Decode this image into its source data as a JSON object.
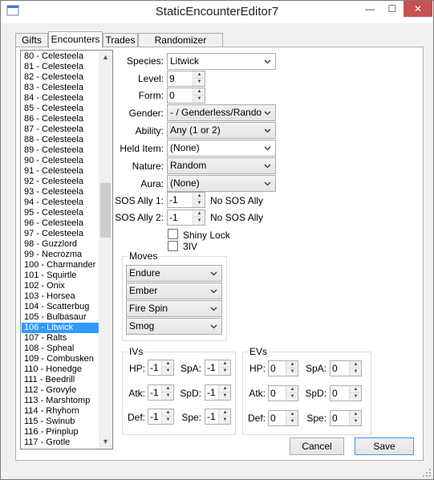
{
  "window": {
    "title": "StaticEncounterEditor7",
    "minimize_glyph": "—",
    "maximize_glyph": "☐",
    "close_glyph": "✕"
  },
  "tabs": [
    {
      "label": "Gifts"
    },
    {
      "label": "Encounters"
    },
    {
      "label": "Trades"
    },
    {
      "label": "Randomizer Options"
    }
  ],
  "active_tab": "Encounters",
  "encounter_list": {
    "items": [
      "80 - Celesteela",
      "81 - Celesteela",
      "82 - Celesteela",
      "83 - Celesteela",
      "84 - Celesteela",
      "85 - Celesteela",
      "86 - Celesteela",
      "87 - Celesteela",
      "88 - Celesteela",
      "89 - Celesteela",
      "90 - Celesteela",
      "91 - Celesteela",
      "92 - Celesteela",
      "93 - Celesteela",
      "94 - Celesteela",
      "95 - Celesteela",
      "96 - Celesteela",
      "97 - Celesteela",
      "98 - Guzzlord",
      "99 - Necrozma",
      "100 - Charmander",
      "101 - Squirtle",
      "102 - Onix",
      "103 - Horsea",
      "104 - Scatterbug",
      "105 - Bulbasaur",
      "106 - Litwick",
      "107 - Ralts",
      "108 - Spheal",
      "109 - Combusken",
      "110 - Honedge",
      "111 - Beedrill",
      "112 - Grovyle",
      "113 - Marshtomp",
      "114 - Rhyhorn",
      "115 - Swinub",
      "116 - Prinplup",
      "117 - Grotle"
    ],
    "selected": "106 - Litwick"
  },
  "form": {
    "species_label": "Species:",
    "species_value": "Litwick",
    "level_label": "Level:",
    "level_value": "9",
    "form_label": "Form:",
    "form_value": "0",
    "gender_label": "Gender:",
    "gender_value": "- / Genderless/Random",
    "ability_label": "Ability:",
    "ability_value": "Any (1 or 2)",
    "held_item_label": "Held Item:",
    "held_item_value": "(None)",
    "nature_label": "Nature:",
    "nature_value": "Random",
    "aura_label": "Aura:",
    "aura_value": "(None)",
    "sos_ally1_label": "SOS Ally 1:",
    "sos_ally1_value": "-1",
    "sos_ally1_text": "No SOS Ally",
    "sos_ally2_label": "SOS Ally 2:",
    "sos_ally2_value": "-1",
    "sos_ally2_text": "No SOS Ally",
    "shiny_lock_label": "Shiny Lock",
    "shiny_lock_checked": false,
    "three_iv_label": "3IV",
    "three_iv_checked": false
  },
  "moves": {
    "legend": "Moves",
    "items": [
      "Endure",
      "Ember",
      "Fire Spin",
      "Smog"
    ]
  },
  "ivs": {
    "legend": "IVs",
    "hp_label": "HP:",
    "hp": "-1",
    "spa_label": "SpA:",
    "spa": "-1",
    "atk_label": "Atk:",
    "atk": "-1",
    "spd_label": "SpD:",
    "spd": "-1",
    "def_label": "Def:",
    "def": "-1",
    "spe_label": "Spe:",
    "spe": "-1"
  },
  "evs": {
    "legend": "EVs",
    "hp_label": "HP:",
    "hp": "0",
    "spa_label": "SpA:",
    "spa": "0",
    "atk_label": "Atk:",
    "atk": "0",
    "spd_label": "SpD:",
    "spd": "0",
    "def_label": "Def:",
    "def": "0",
    "spe_label": "Spe:",
    "spe": "0"
  },
  "buttons": {
    "cancel": "Cancel",
    "save": "Save"
  }
}
